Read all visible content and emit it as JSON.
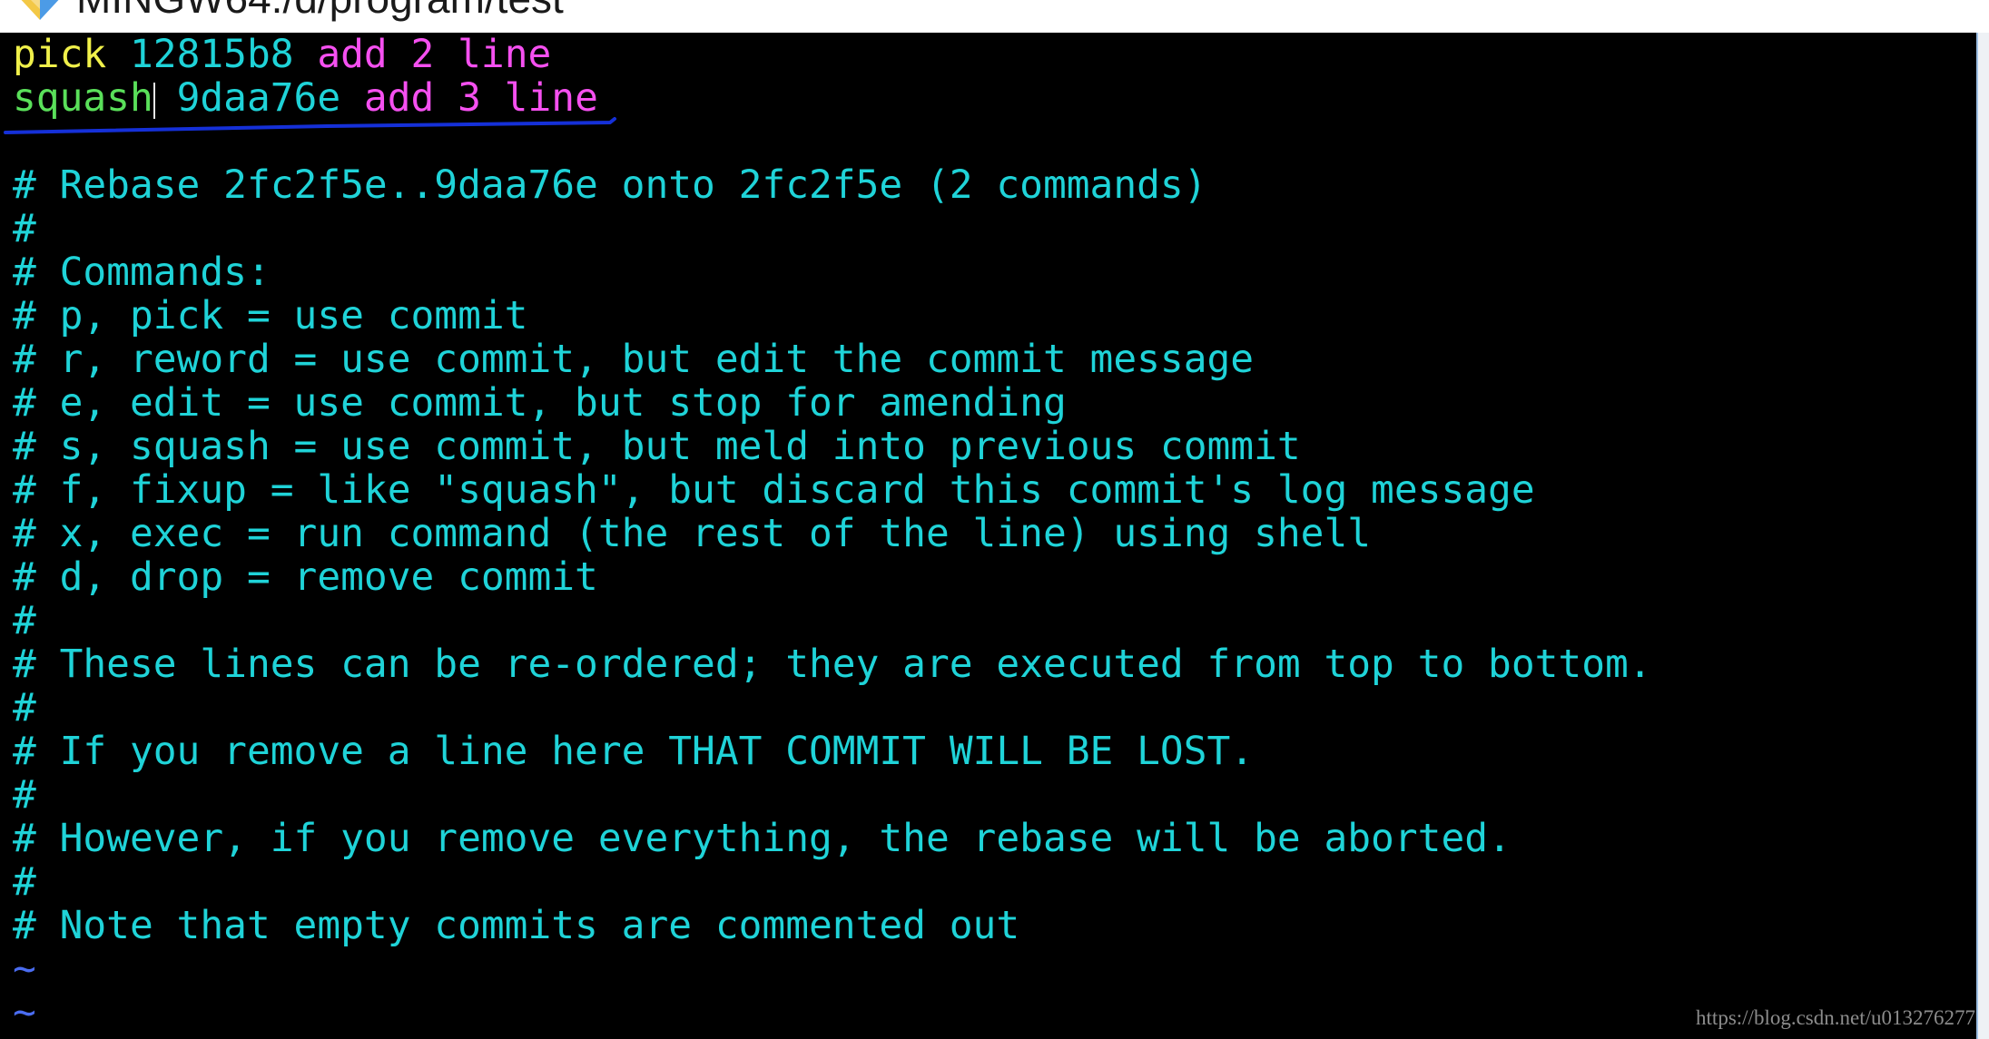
{
  "window": {
    "title": "MINGW64:/d/program/test",
    "icon": "git-bash-icon"
  },
  "editor": {
    "todo": [
      {
        "command": "pick",
        "hash": "12815b8",
        "message": "add 2 line"
      },
      {
        "command": "squash",
        "hash": "9daa76e",
        "message": "add 3 line"
      }
    ],
    "comments": [
      "# Rebase 2fc2f5e..9daa76e onto 2fc2f5e (2 commands)",
      "#",
      "# Commands:",
      "# p, pick = use commit",
      "# r, reword = use commit, but edit the commit message",
      "# e, edit = use commit, but stop for amending",
      "# s, squash = use commit, but meld into previous commit",
      "# f, fixup = like \"squash\", but discard this commit's log message",
      "# x, exec = run command (the rest of the line) using shell",
      "# d, drop = remove commit",
      "#",
      "# These lines can be re-ordered; they are executed from top to bottom.",
      "#",
      "# If you remove a line here THAT COMMIT WILL BE LOST.",
      "#",
      "# However, if you remove everything, the rebase will be aborted.",
      "#",
      "# Note that empty commits are commented out"
    ],
    "filler": [
      "~",
      "~"
    ]
  },
  "watermark": "https://blog.csdn.net/u013276277",
  "colors": {
    "title_bar": "#ffffff",
    "title_text": "#1a1a1a",
    "terminal_bg": "#000000",
    "pick": "#f0f04a",
    "squash": "#5ae05a",
    "hash": "#1fd3d8",
    "message": "#f550f0",
    "comment": "#1fd3d8",
    "filler": "#4a6cf0",
    "cursor": "#e6e6e6",
    "annotation": "#1530d8",
    "watermark": "#8c8c8c"
  }
}
